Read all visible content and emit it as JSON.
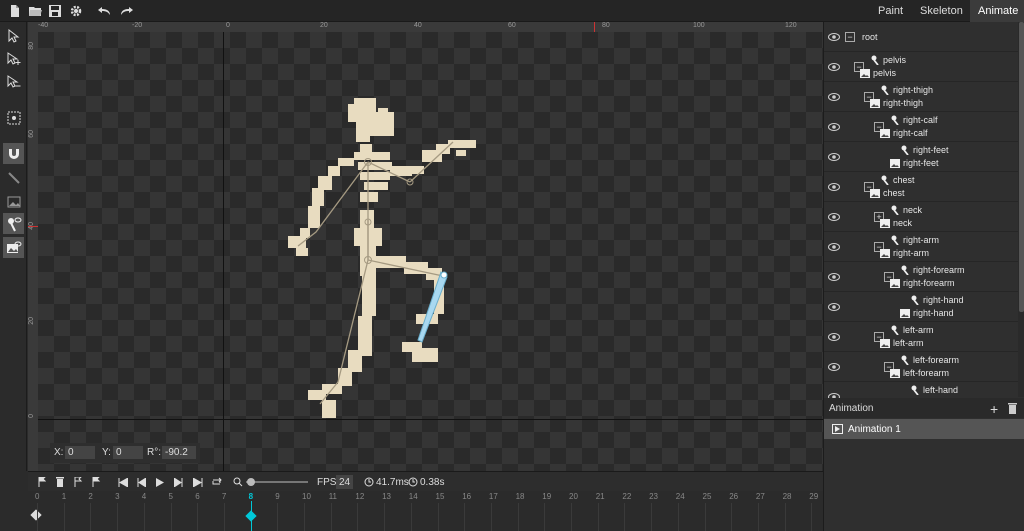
{
  "toolbar": {
    "icons": [
      "new-file-icon",
      "open-folder-icon",
      "save-icon",
      "settings-icon",
      "undo-icon",
      "redo-icon"
    ]
  },
  "modes": [
    {
      "label": "Paint",
      "active": false
    },
    {
      "label": "Skeleton",
      "active": false
    },
    {
      "label": "Animate",
      "active": true
    }
  ],
  "ruler": {
    "top": [
      "-40",
      "-20",
      "0",
      "20",
      "40",
      "60",
      "80",
      "100",
      "120"
    ],
    "left": [
      "80",
      "60",
      "40",
      "20",
      "0"
    ]
  },
  "coords": {
    "x_label": "X:",
    "x_value": "0",
    "y_label": "Y:",
    "y_value": "0",
    "r_label": "R°:",
    "r_value": "-90.2"
  },
  "playback": {
    "fps_label": "FPS:",
    "fps_value": "24",
    "frame_time": "41.7ms",
    "duration": "0.38s"
  },
  "timeline": {
    "frames": [
      "0",
      "1",
      "2",
      "3",
      "4",
      "5",
      "6",
      "7",
      "8",
      "9",
      "10",
      "11",
      "12",
      "13",
      "14",
      "15",
      "16",
      "17",
      "18",
      "19",
      "20",
      "21",
      "22",
      "23",
      "24",
      "25",
      "26",
      "27",
      "28",
      "29"
    ],
    "current_frame": "8"
  },
  "tree": {
    "root": "root",
    "rows": [
      {
        "bone": "pelvis",
        "image": "pelvis",
        "expander": "−"
      },
      {
        "bone": "right-thigh",
        "image": "right-thigh",
        "expander": "−"
      },
      {
        "bone": "right-calf",
        "image": "right-calf",
        "expander": "−"
      },
      {
        "bone": "right-feet",
        "image": "right-feet",
        "expander": ""
      },
      {
        "bone": "chest",
        "image": "chest",
        "expander": "−"
      },
      {
        "bone": "neck",
        "image": "neck",
        "expander": "+"
      },
      {
        "bone": "right-arm",
        "image": "right-arm",
        "expander": "−"
      },
      {
        "bone": "right-forearm",
        "image": "right-forearm",
        "expander": "−"
      },
      {
        "bone": "right-hand",
        "image": "right-hand",
        "expander": ""
      },
      {
        "bone": "left-arm",
        "image": "left-arm",
        "expander": "−"
      },
      {
        "bone": "left-forearm",
        "image": "left-forearm",
        "expander": "−"
      },
      {
        "bone": "left-hand",
        "image": "",
        "expander": ""
      }
    ]
  },
  "animation": {
    "header": "Animation",
    "items": [
      "Animation 1"
    ]
  },
  "colors": {
    "accent": "#00c8d8",
    "bone": "#e8dcc0",
    "selected_bone": "#a8d8f0"
  }
}
